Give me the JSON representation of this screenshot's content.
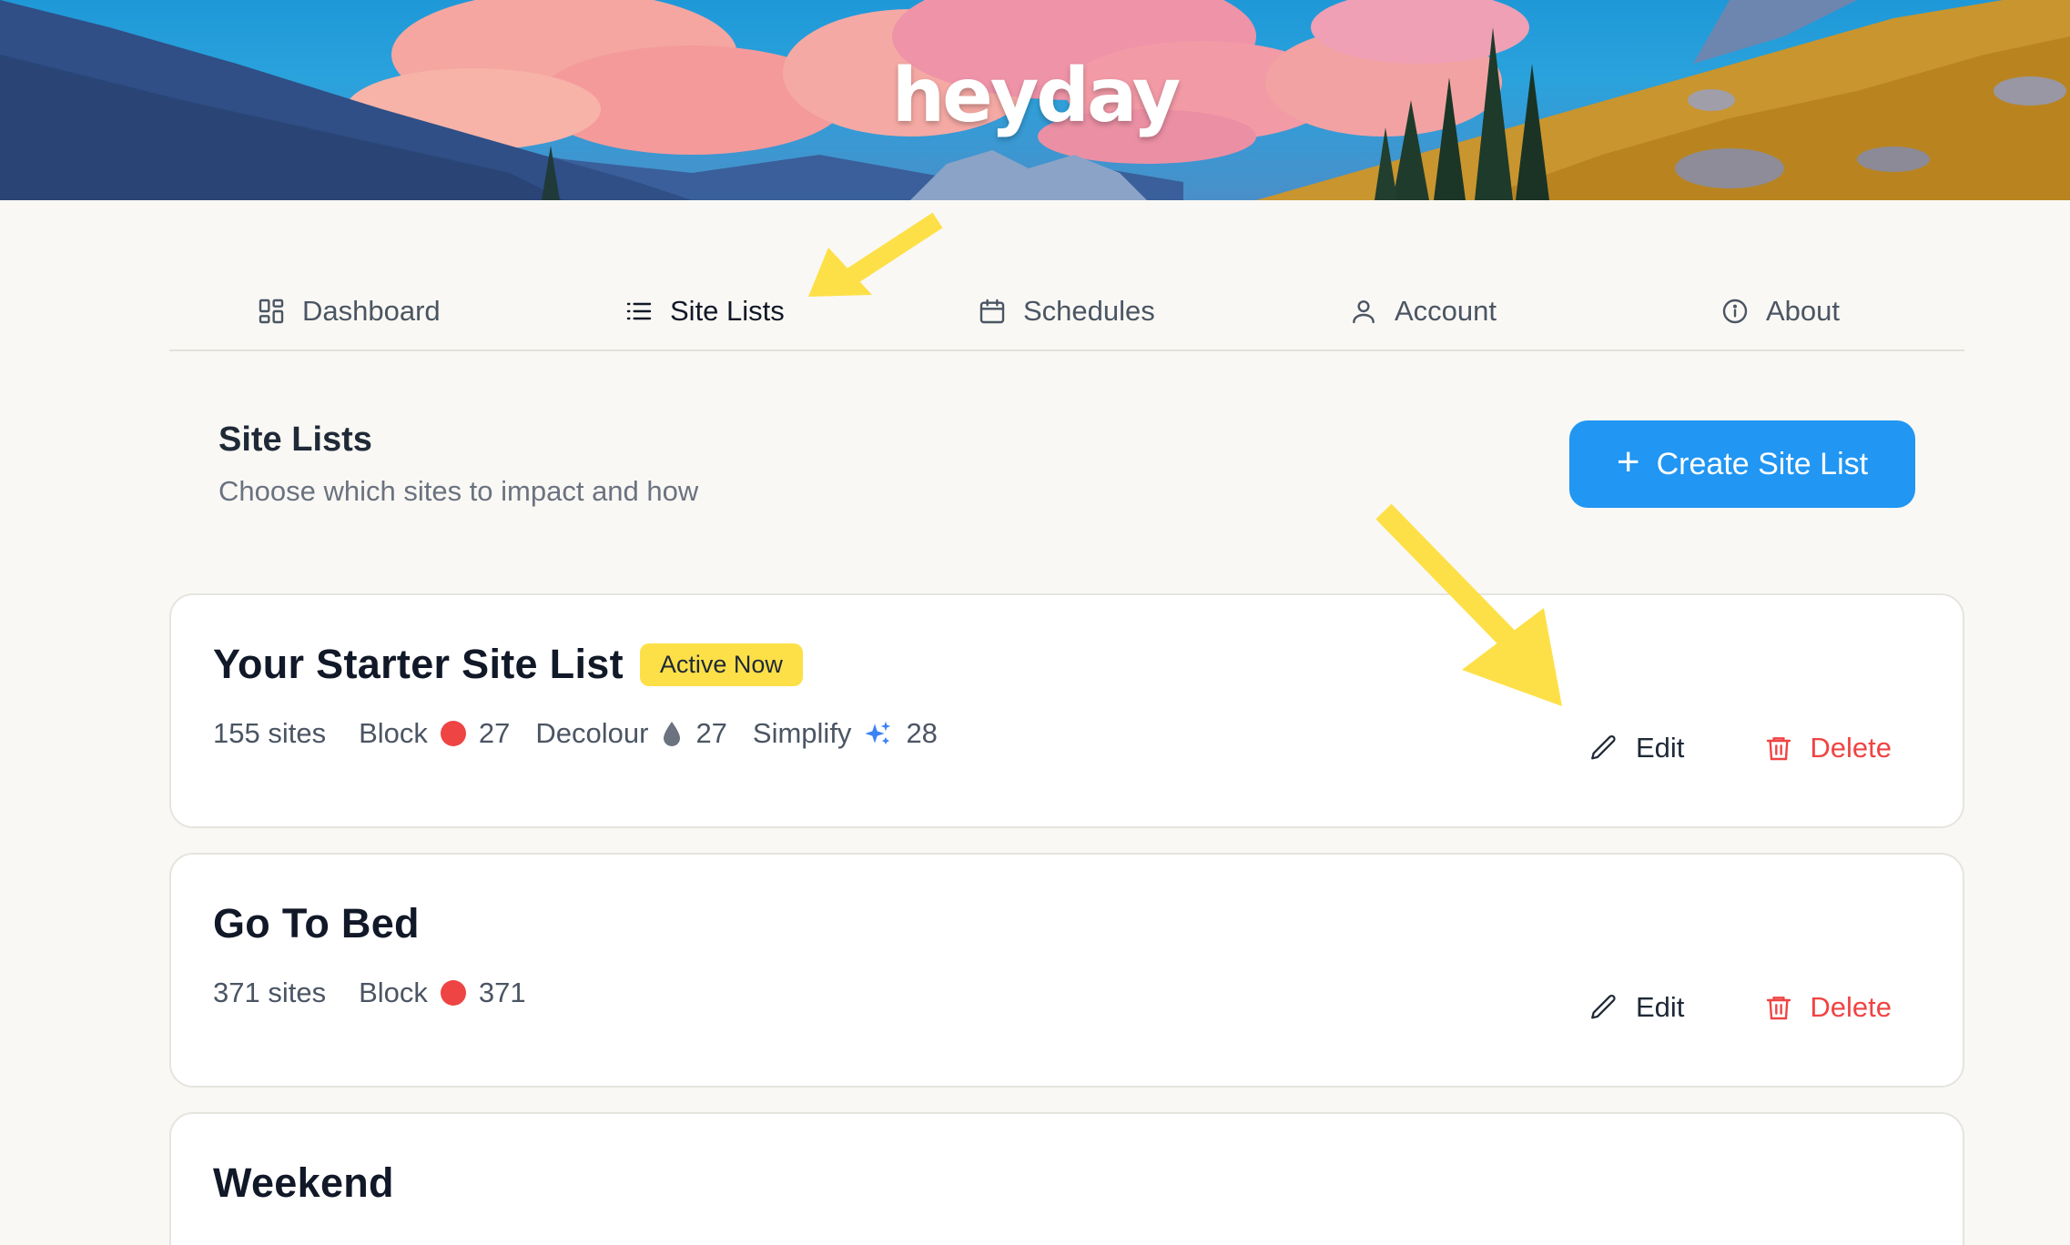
{
  "brand": {
    "logo": "heyday"
  },
  "nav": {
    "items": [
      {
        "label": "Dashboard",
        "icon": "dashboard-grid-icon"
      },
      {
        "label": "Site Lists",
        "icon": "list-icon"
      },
      {
        "label": "Schedules",
        "icon": "calendar-icon"
      },
      {
        "label": "Account",
        "icon": "user-icon"
      },
      {
        "label": "About",
        "icon": "info-icon"
      }
    ],
    "active": "Site Lists"
  },
  "header": {
    "title": "Site Lists",
    "subtitle": "Choose which sites to impact and how",
    "create_button": "Create Site List"
  },
  "site_lists": [
    {
      "name": "Your Starter Site List",
      "badge": "Active Now",
      "sites": "155 sites",
      "block_label": "Block",
      "block_count": "27",
      "decolour_label": "Decolour",
      "decolour_count": "27",
      "simplify_label": "Simplify",
      "simplify_count": "28",
      "edit_label": "Edit",
      "delete_label": "Delete"
    },
    {
      "name": "Go To Bed",
      "sites": "371 sites",
      "block_label": "Block",
      "block_count": "371",
      "edit_label": "Edit",
      "delete_label": "Delete"
    },
    {
      "name": "Weekend"
    }
  ],
  "colors": {
    "accent": "#2196f3",
    "badge": "#fde047",
    "block_dot": "#ef4444",
    "delete": "#ef4444",
    "simplify": "#3b82f6",
    "arrow": "#fde047",
    "background": "#f9f8f4"
  }
}
